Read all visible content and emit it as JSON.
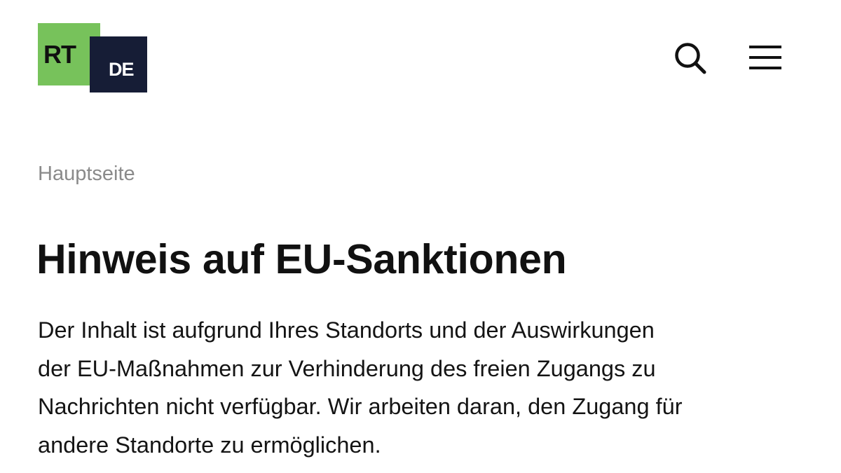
{
  "header": {
    "logo": {
      "primary_text": "RT",
      "secondary_text": "DE",
      "colors": {
        "green": "#77c25b",
        "navy": "#161d36"
      }
    },
    "search_icon": "search-icon",
    "menu_icon": "hamburger-menu-icon"
  },
  "breadcrumb": {
    "home_label": "Hauptseite"
  },
  "main": {
    "title": "Hinweis auf EU-Sanktionen",
    "notice_lines": [
      "Der Inhalt ist aufgrund Ihres Standorts und der Auswirkungen",
      "der EU-Maßnahmen zur Verhinderung des freien Zugangs zu",
      "Nachrichten nicht verfügbar. Wir arbeiten daran, den Zugang für",
      "andere Standorte zu ermöglichen."
    ]
  }
}
